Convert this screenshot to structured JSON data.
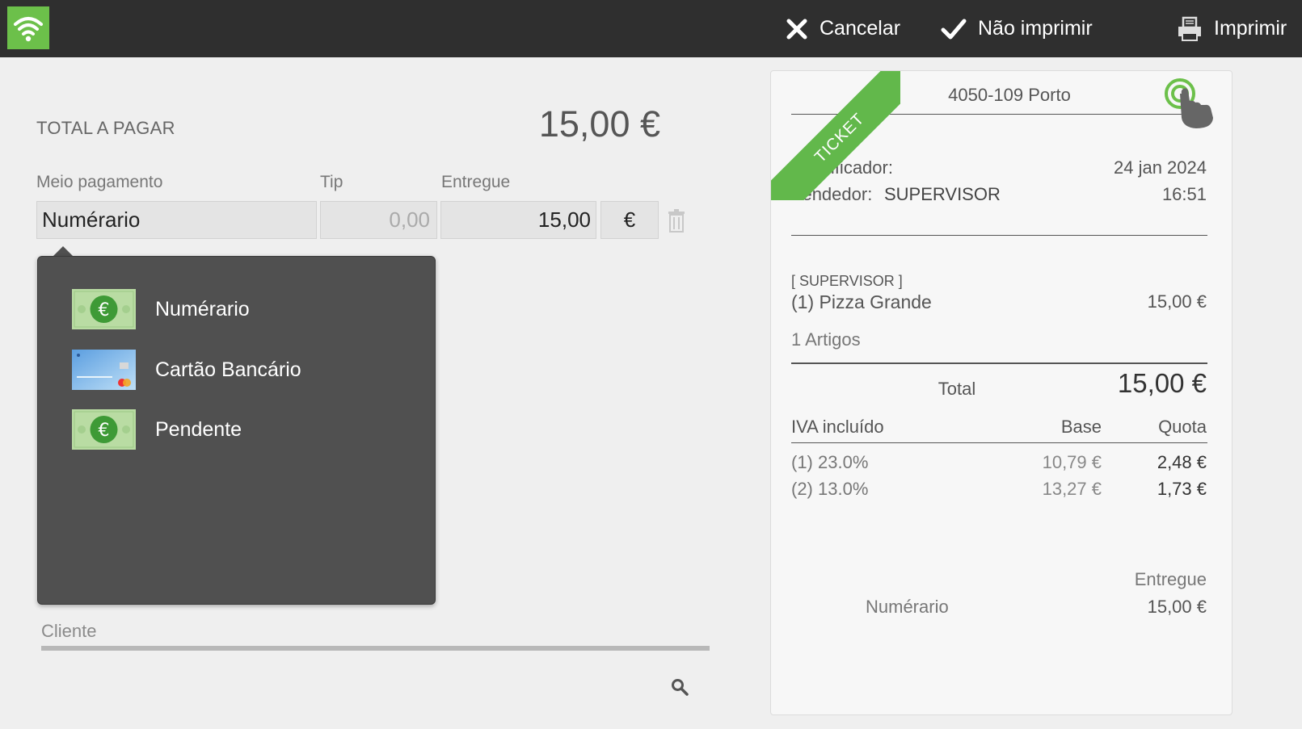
{
  "header": {
    "cancel_label": "Cancelar",
    "no_print_label": "Não imprimir",
    "print_label": "Imprimir",
    "accent_color": "#6cc04a"
  },
  "payment": {
    "total_label": "TOTAL A PAGAR",
    "total_value": "15,00 €",
    "method_header": "Meio pagamento",
    "tip_header": "Tip",
    "delivered_header": "Entregue",
    "method_value": "Numérario",
    "tip_value": "0,00",
    "delivered_value": "15,00",
    "currency": "€"
  },
  "popup": {
    "items": [
      {
        "label": "Numérario",
        "icon": "cash-banknote-icon"
      },
      {
        "label": "Cartão Bancário",
        "icon": "bank-card-icon"
      },
      {
        "label": "Pendente",
        "icon": "cash-banknote-icon"
      }
    ]
  },
  "client": {
    "label": "Cliente"
  },
  "receipt": {
    "ribbon": "TICKET",
    "address": "4050-109 Porto",
    "identifier_label": "Identificador:",
    "date": "24 jan 2024",
    "seller_label": "Vendedor:",
    "seller_name": "SUPERVISOR",
    "time": "16:51",
    "section_tag": "[ SUPERVISOR ]",
    "line_item": "(1) Pizza Grande",
    "line_price": "15,00 €",
    "items_count": "1 Artigos",
    "total_label": "Total",
    "total_value": "15,00 €",
    "tax_header": "IVA incluído",
    "base_header": "Base",
    "quota_header": "Quota",
    "taxes": [
      {
        "rate": "(1) 23.0%",
        "base": "10,79 €",
        "quota": "2,48 €"
      },
      {
        "rate": "(2) 13.0%",
        "base": "13,27 €",
        "quota": "1,73 €"
      }
    ],
    "delivered_header": "Entregue",
    "delivered_method": "Numérario",
    "delivered_value": "15,00 €"
  }
}
